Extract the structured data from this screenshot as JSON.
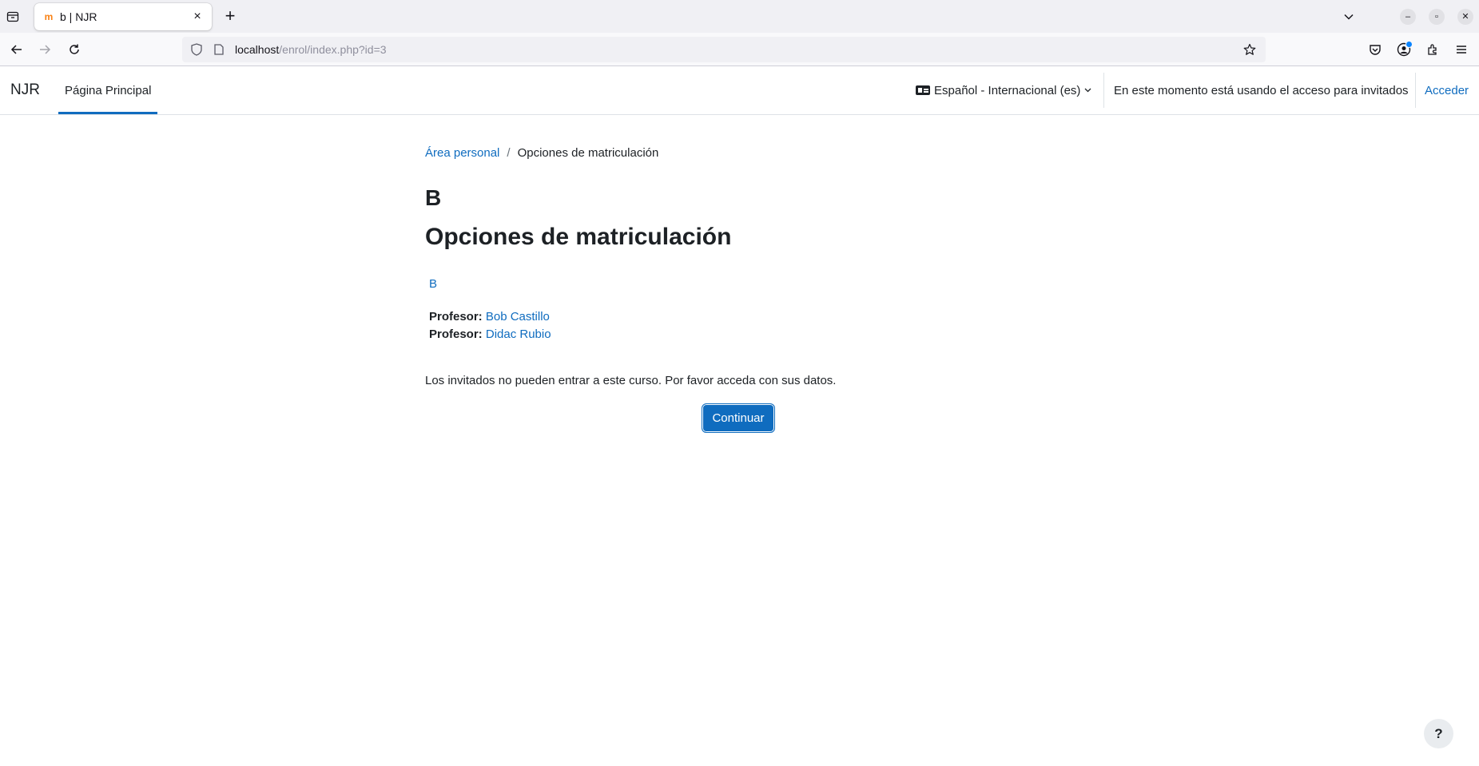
{
  "browser": {
    "tab_title": "b | NJR",
    "url_host": "localhost",
    "url_path": "/enrol/index.php?id=3",
    "favicon_icon": "moodle-favicon-icon",
    "new_tab_label": "+",
    "win_minimize": "–",
    "win_restore": "▫",
    "win_close": "✕",
    "tab_close": "×"
  },
  "site": {
    "brand": "NJR",
    "primary_nav": "Página Principal",
    "language": "Español - Internacional (es)",
    "guest_notice": "En este momento está usando el acceso para invitados",
    "login": "Acceder"
  },
  "page": {
    "breadcrumb": [
      "Área personal",
      "Opciones de matriculación"
    ],
    "breadcrumb_sep": "/",
    "course_short": "B",
    "heading": "Opciones de matriculación",
    "course_link": "B",
    "teachers": [
      {
        "role": "Profesor:",
        "name": "Bob Castillo"
      },
      {
        "role": "Profesor:",
        "name": "Didac Rubio"
      }
    ],
    "notice": "Los invitados no pueden entrar a este curso. Por favor acceda con sus datos.",
    "continue_button": "Continuar",
    "help": "?"
  },
  "colors": {
    "accent": "#0f6cbf",
    "text": "#1d2125",
    "chrome_bg": "#f0f0f4"
  }
}
